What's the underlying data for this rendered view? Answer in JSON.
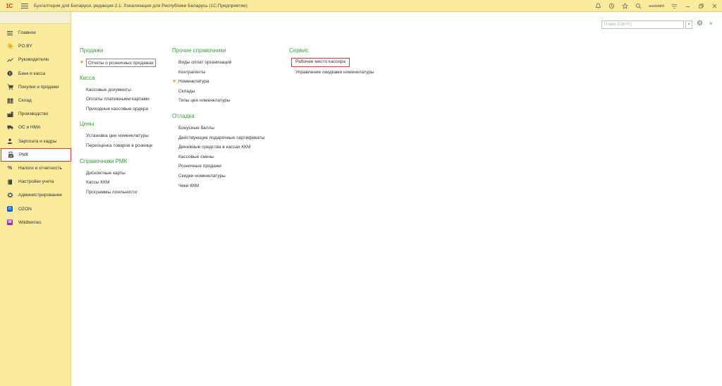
{
  "titlebar": {
    "logo": "1С",
    "title": "Бухгалтерия для Беларуси, редакция 2.1. Локализация для Республики Беларусь  (1С:Предприятие)",
    "user": "assistant"
  },
  "sidebar": {
    "items": [
      {
        "label": "Главное",
        "icon": "menu-lines-icon"
      },
      {
        "label": "PO.BY",
        "icon": "star-burst-icon"
      },
      {
        "label": "Руководителю",
        "icon": "trend-icon"
      },
      {
        "label": "Банк и касса",
        "icon": "coin-icon"
      },
      {
        "label": "Покупки и продажи",
        "icon": "cart-icon"
      },
      {
        "label": "Склад",
        "icon": "warehouse-icon"
      },
      {
        "label": "Производство",
        "icon": "factory-icon"
      },
      {
        "label": "ОС и НМА",
        "icon": "truck-icon"
      },
      {
        "label": "Зарплата и кадры",
        "icon": "person-icon"
      },
      {
        "label": "РМК",
        "icon": "cash-register-icon"
      },
      {
        "label": "Налоги и отчетность",
        "icon": "percent-icon"
      },
      {
        "label": "Настройки учета",
        "icon": "book-icon"
      },
      {
        "label": "Администрирование",
        "icon": "gear-icon"
      },
      {
        "label": "OZON",
        "icon": "ozon-icon"
      },
      {
        "label": "Wildberries",
        "icon": "wildberries-icon"
      }
    ]
  },
  "search": {
    "placeholder": "Поиск (Ctrl+F)"
  },
  "columns": {
    "col1": {
      "sales": {
        "title": "Продажи",
        "items": [
          "Отчеты о розничных продажах"
        ]
      },
      "cash": {
        "title": "Касса",
        "items": [
          "Кассовые документы",
          "Оплаты платежными картами",
          "Приходные кассовые ордера"
        ]
      },
      "prices": {
        "title": "Цены",
        "items": [
          "Установка цен номенклатуры",
          "Переоценка товаров в рознице"
        ]
      },
      "rmk_refs": {
        "title": "Справочники РМК",
        "items": [
          "Дисконтные карты",
          "Кассы ККМ",
          "Программы лояльности"
        ]
      }
    },
    "col2": {
      "other_refs": {
        "title": "Прочие справочники",
        "items": [
          "Виды оплат организаций",
          "Контрагенты",
          "Номенклатура",
          "Склады",
          "Типы цен номенклатуры"
        ]
      },
      "debug": {
        "title": "Отладка",
        "items": [
          "Бонусные баллы",
          "Действующие подарочные сертификаты",
          "Денежные средства в кассах ККМ",
          "Кассовые смены",
          "Розничные продажи",
          "Скидки номенклатуры",
          "Чеки ККМ"
        ]
      }
    },
    "col3": {
      "service": {
        "title": "Сервис",
        "items": [
          "Рабочее место кассира",
          "Управление скидками номенклатуры"
        ]
      }
    }
  },
  "colors": {
    "sidebar_bg": "#fbeb9c",
    "group_title": "#3b9e3b",
    "highlight": "#e2382f",
    "star": "#e8a317"
  }
}
